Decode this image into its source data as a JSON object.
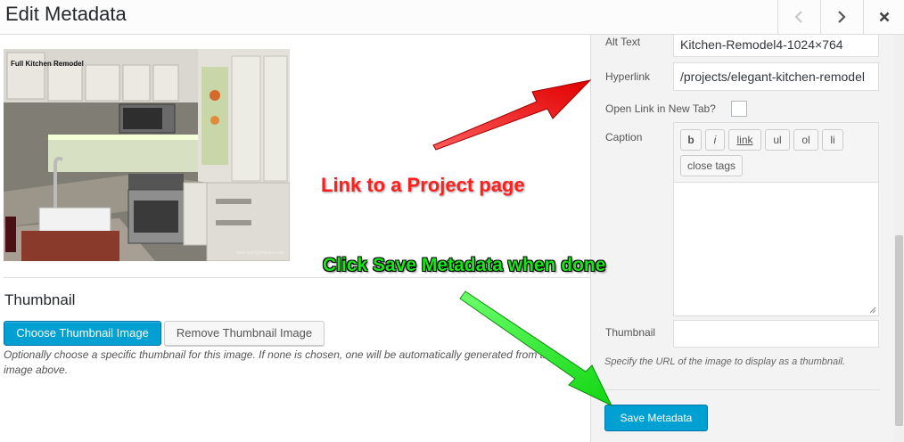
{
  "header": {
    "title": "Edit Metadata",
    "prev_icon": "chevron-left-icon",
    "next_icon": "chevron-right-icon",
    "close_icon": "close-icon"
  },
  "image": {
    "caption_text": "Full Kitchen Remodel",
    "watermark_text": "www.layingdowninc.com"
  },
  "thumbnail_section": {
    "title": "Thumbnail",
    "choose_label": "Choose Thumbnail Image",
    "remove_label": "Remove Thumbnail Image",
    "help_text": "Optionally choose a specific thumbnail for this image. If none is chosen, one will be automatically generated from the image above."
  },
  "panel": {
    "alt_text_label": "Alt Text",
    "alt_text_value": "Kitchen-Remodel4-1024×764",
    "hyperlink_label": "Hyperlink",
    "hyperlink_value": "/projects/elegant-kitchen-remodel",
    "open_new_tab_label": "Open Link in New Tab?",
    "caption_label": "Caption",
    "caption_tags": [
      "b",
      "i",
      "link",
      "ul",
      "ol",
      "li"
    ],
    "close_tags_label": "close tags",
    "caption_value": "",
    "thumbnail_label": "Thumbnail",
    "thumbnail_value": "",
    "thumbnail_help": "Specify the URL of the image to display as a thumbnail.",
    "save_label": "Save Metadata"
  },
  "annotations": {
    "red_text": "Link to a Project page",
    "green_text": "Click Save Metadata when done"
  },
  "colors": {
    "primary": "#00a0d2",
    "red_annotation": "#ff1f1f",
    "green_annotation": "#19e619"
  }
}
